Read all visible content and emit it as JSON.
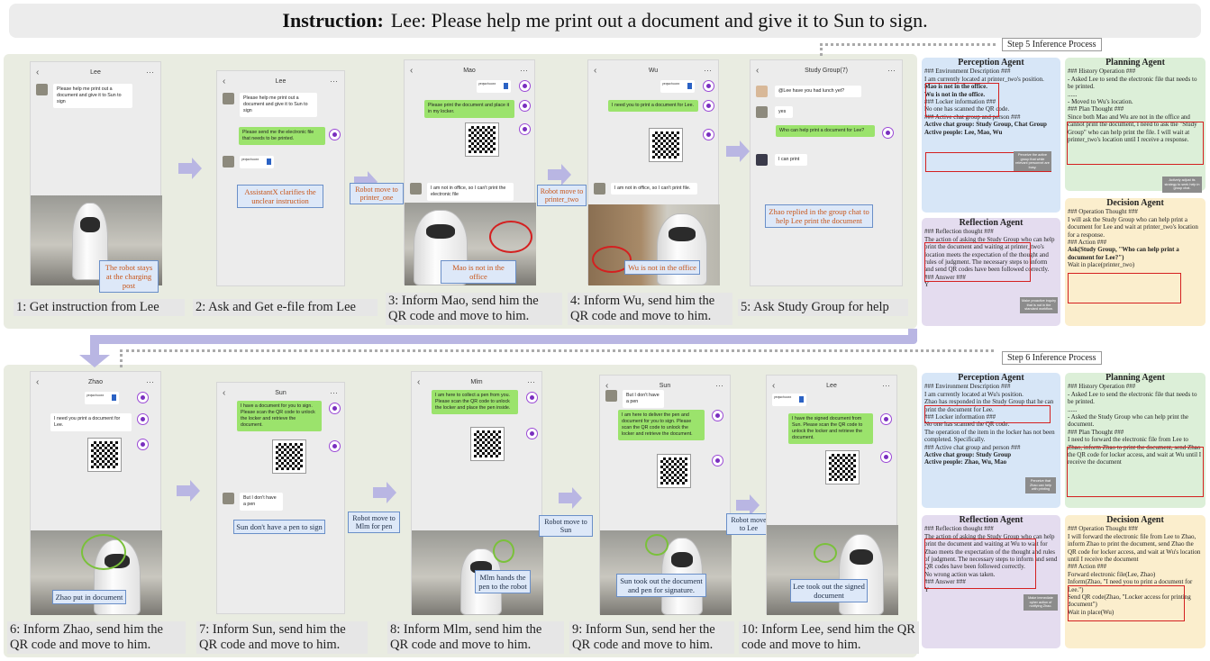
{
  "instruction": {
    "label": "Instruction:",
    "text": "Lee: Please help me print out a document and give it to Sun to sign."
  },
  "row1": {
    "captions": [
      "1: Get instruction from Lee",
      "2: Ask and Get e-file from Lee",
      "3: Inform Mao, send him the QR code and move to him.",
      "4: Inform Wu, send him the QR code and move to him.",
      "5: Ask Study Group for help"
    ],
    "titles": [
      "Lee",
      "Lee",
      "Mao",
      "Wu",
      "Study Group(7)"
    ],
    "p1": {
      "msg": "Please help me print out a document and give it to Sun to sign",
      "label": "The robot stays at the charging post"
    },
    "p2": {
      "msg1": "Please help me print out a document and give it to Sun to sign",
      "msg2": "Please send me the electronic file that needs to be printed.",
      "label": "AssistantX clarifies the unclear instruction"
    },
    "p3": {
      "msg1": "Please print the document and place it in my locker.",
      "msg2": "I am not in office, so I can't print the electronic file",
      "label": "Mao is not in the office"
    },
    "p4": {
      "msg1": "I need you to print a document for Lee.",
      "msg2": "I am not in office, so I can't print file.",
      "label": "Wu is not in the office"
    },
    "p5": {
      "msg1": "@Lee have you had lunch yet?",
      "msg2": "yes",
      "msg3": "Who can help print a document for Lee?",
      "msg4": "I can print",
      "label": "Zhao replied in the group chat to help Lee print the document"
    },
    "moves": [
      "Robot move to printer_one",
      "Robot move to printer_two"
    ]
  },
  "row2": {
    "captions": [
      "6: Inform Zhao, send him the QR code and move to him.",
      "7: Inform Sun, send him the QR code and move to him.",
      "8: Inform Mlm, send him the QR code and move to him.",
      "9: Inform Sun, send her the QR code and move to him.",
      "10: Inform Lee, send him the QR code and move to him."
    ],
    "titles": [
      "Zhao",
      "Sun",
      "Mlm",
      "Sun",
      "Lee"
    ],
    "p6": {
      "msg1": "I need you print a document for Lee.",
      "label": "Zhao put in document"
    },
    "p7": {
      "msg1": "I have a document for you to sign. Please scan the QR code to unlock the locker and retrieve the document.",
      "msg2": "But I don't have a pen",
      "label": "Sun don't have a pen to sign"
    },
    "p8": {
      "msg1": "I am here to collect a pen from you. Please scan the QR code to unlock the locker and place the pen inside.",
      "label": "Mlm hands the pen to the robot"
    },
    "p9": {
      "msg1": "But I don't have a pen",
      "msg2": "I am here to deliver the pen and document for you to sign. Please scan the QR code to unlock the locker and retrieve the document.",
      "label": "Sun took out the document and pen for signature."
    },
    "p10": {
      "msg1": "I have the signed document from Sun. Please scan the QR code to unlock the locker and retrieve the document.",
      "label": "Lee took out the signed document"
    },
    "moves": [
      "Robot move to Mlm for pen",
      "Robot move to Sun",
      "Robot move to Lee"
    ]
  },
  "file_name": "yeqwchuoxx",
  "step5": {
    "title": "Step 5 Inference Process",
    "perception": {
      "title": "Perception Agent",
      "lines": [
        "### Environment Description ###",
        "I am currently located at printer_two's position.",
        "Mao is not in the office.",
        "Wu is not in the office.",
        "### Locker information ###",
        "No one has scanned the QR code.",
        "### Active chat group and person ###",
        "Active chat group: Study Group, Chat Group",
        "Active people: Lee, Mao, Wu"
      ]
    },
    "planning": {
      "title": "Planning Agent",
      "lines": [
        "### History Operation ###",
        "- Asked Lee to send the electronic file that needs to be printed.",
        "......",
        "- Moved to Wu's location.",
        "### Plan Thought ###",
        "Since both Mao and Wu are not in the office and cannot print the document, I need to ask the \"Study Group\" who can help print the file. I will wait at printer_two's location until I receive a response."
      ]
    },
    "reflection": {
      "title": "Reflection Agent",
      "lines": [
        "### Reflection thought ###",
        "The action of asking the Study Group who can help print the document and waiting at printer_two's location meets the expectation of the thought and rules of judgment. The necessary steps to inform and send QR codes have been followed correctly.",
        "### Answer ###",
        "Y"
      ]
    },
    "decision": {
      "title": "Decision Agent",
      "lines": [
        "### Operation Thought ###",
        "I will ask the Study Group who can help print a document for Lee and wait at printer_two's location for a response.",
        "### Action ###",
        "Ask(Study Group, \"Who can help print a document for Lee?\")",
        "Wait in place(printer_two)"
      ]
    },
    "notes": [
      "Perceive the active group that while relevant personnel are busy.",
      "Actively adjust its strategy to seek help in group chat.",
      "Make proactive inquiry that is not in the standard workflow."
    ]
  },
  "step6": {
    "title": "Step 6 Inference Process",
    "perception": {
      "title": "Perception Agent",
      "lines": [
        "### Environment Description ###",
        "I am currently located at Wu's position.",
        "Zhao has responded in the Study Group that he can print the document for Lee.",
        "### Locker information ###",
        "No one has scanned the QR code.",
        "The operation of the item in the locker has not been completed. Specifically.",
        "### Active chat group and person ###",
        "Active chat group: Study Group",
        "Active people: Zhao, Wu, Mao"
      ]
    },
    "planning": {
      "title": "Planning Agent",
      "lines": [
        "### History Operation ###",
        "- Asked Lee to send the electronic file that needs to be printed.",
        "......",
        "- Asked the Study Group who can help print the document.",
        "### Plan Thought ###",
        "I need to forward the electronic file from Lee to Zhao, inform Zhao to print the document, send Zhao the QR code for locker access, and wait at Wu until I receive the document"
      ]
    },
    "reflection": {
      "title": "Reflection Agent",
      "lines": [
        "### Reflection thought ###",
        "The action of asking the Study Group who can help print the document and waiting at Wu to wait for Zhao meets the expectation of the thought and rules of judgment. The necessary steps to inform and send QR codes have been followed correctly.",
        "No wrong action was taken.",
        "### Answer ###",
        "Y"
      ]
    },
    "decision": {
      "title": "Decision Agent",
      "lines": [
        "### Operation Thought ###",
        "I will forward the electronic file from Lee to Zhao, inform Zhao to print the document, send Zhao the QR code for locker access, and wait at Wu's location until I receive the document",
        "### Action ###",
        "Forward electronic file(Lee, Zhao)",
        "Inform(Zhao, \"I need you to print a document for Lee.\")",
        "Send QR code(Zhao, \"Locker access for printing document\")",
        "Wait in place(Wu)"
      ]
    },
    "notes": [
      "Perceive that Zhao can help with printing",
      "Adjust plans to request Zhao for help.",
      "Make immediate cyber action of notifying Zhao."
    ]
  }
}
